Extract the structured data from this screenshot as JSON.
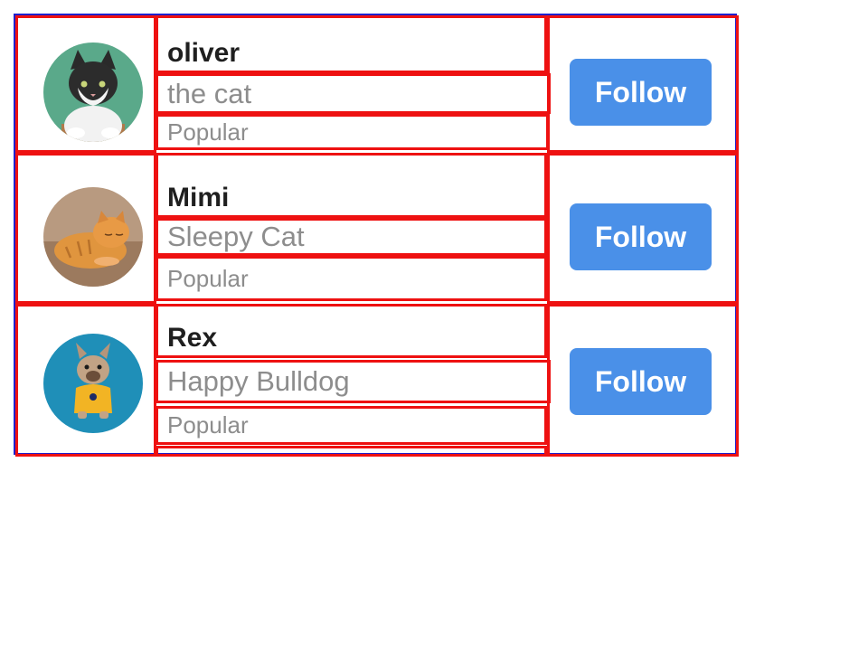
{
  "users": [
    {
      "name": "oliver",
      "subtitle": "the cat",
      "tag": "Popular",
      "button": "Follow",
      "avatar": "cat-black-white-avatar",
      "avatar_bg": "#5aa98a"
    },
    {
      "name": "Mimi",
      "subtitle": "Sleepy Cat",
      "tag": "Popular",
      "button": "Follow",
      "avatar": "orange-tabby-cat-avatar",
      "avatar_bg": "#b89a80"
    },
    {
      "name": "Rex",
      "subtitle": "Happy Bulldog",
      "tag": "Popular",
      "button": "Follow",
      "avatar": "french-bulldog-avatar",
      "avatar_bg": "#1f8fb8"
    }
  ],
  "colors": {
    "accent": "#4a90e8",
    "outline": "#ee1111",
    "frame": "#1f1fcc"
  }
}
